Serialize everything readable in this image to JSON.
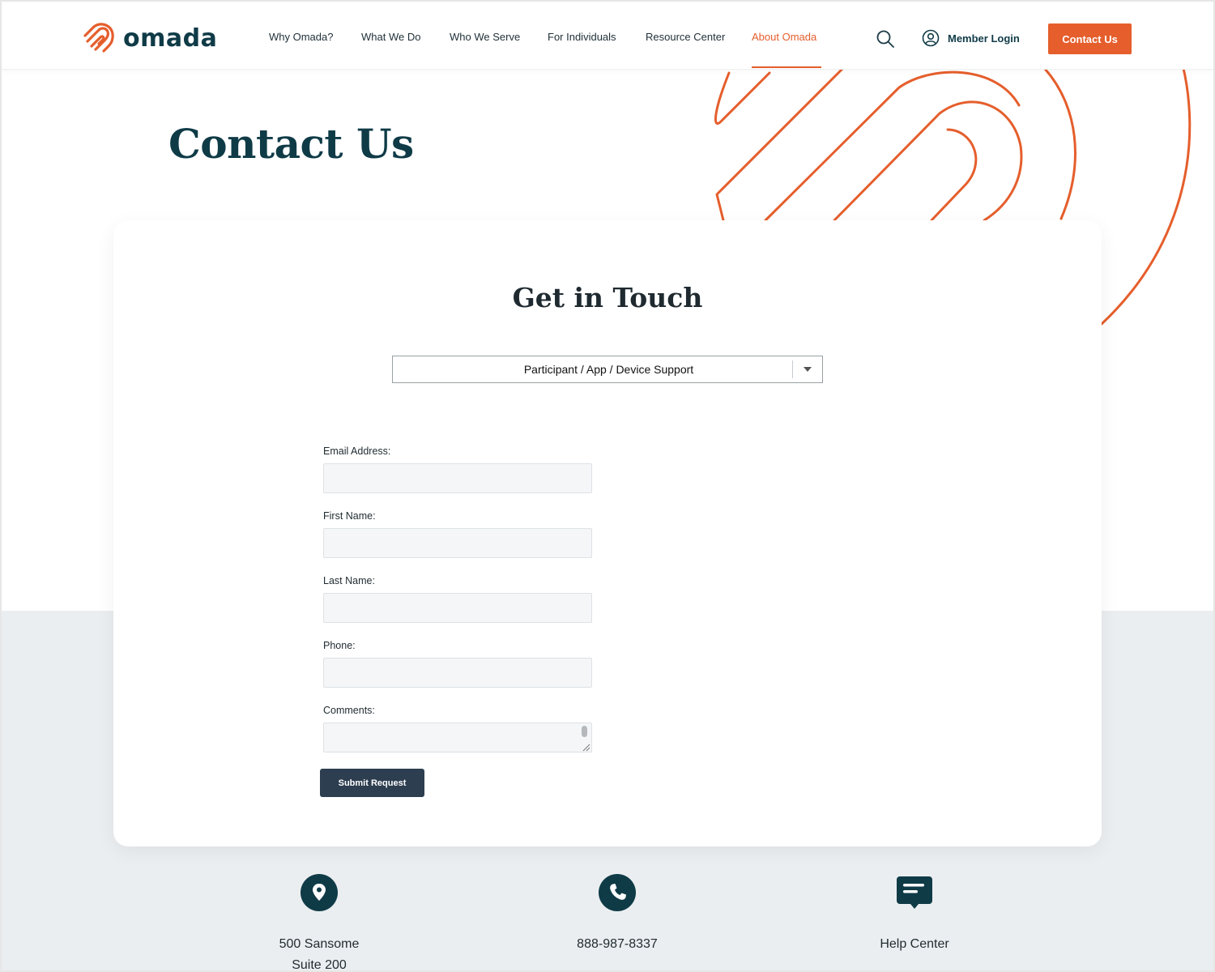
{
  "brand": {
    "name": "omada",
    "accent_color": "#e55e2c",
    "primary_color": "#0f3b47"
  },
  "nav": {
    "items": [
      {
        "label": "Why Omada?",
        "active": false
      },
      {
        "label": "What We Do",
        "active": false
      },
      {
        "label": "Who We Serve",
        "active": false
      },
      {
        "label": "For Individuals",
        "active": false
      },
      {
        "label": "Resource Center",
        "active": false
      },
      {
        "label": "About Omada",
        "active": true
      }
    ],
    "search_icon": "search-icon",
    "member_login_label": "Member Login",
    "contact_button_label": "Contact Us"
  },
  "page": {
    "title": "Contact Us"
  },
  "form": {
    "title": "Get in Touch",
    "topic_select": {
      "selected": "Participant / App / Device Support"
    },
    "fields": [
      {
        "label": "Email Address:",
        "value": ""
      },
      {
        "label": "First Name:",
        "value": ""
      },
      {
        "label": "Last Name:",
        "value": ""
      },
      {
        "label": "Phone:",
        "value": ""
      },
      {
        "label": "Comments:",
        "value": ""
      }
    ],
    "submit_label": "Submit Request"
  },
  "contact_info": [
    {
      "icon": "location-pin-icon",
      "lines": [
        "500 Sansome",
        "Suite 200"
      ]
    },
    {
      "icon": "phone-icon",
      "lines": [
        "888-987-8337"
      ]
    },
    {
      "icon": "chat-bubble-icon",
      "lines": [
        "Help Center"
      ]
    }
  ]
}
